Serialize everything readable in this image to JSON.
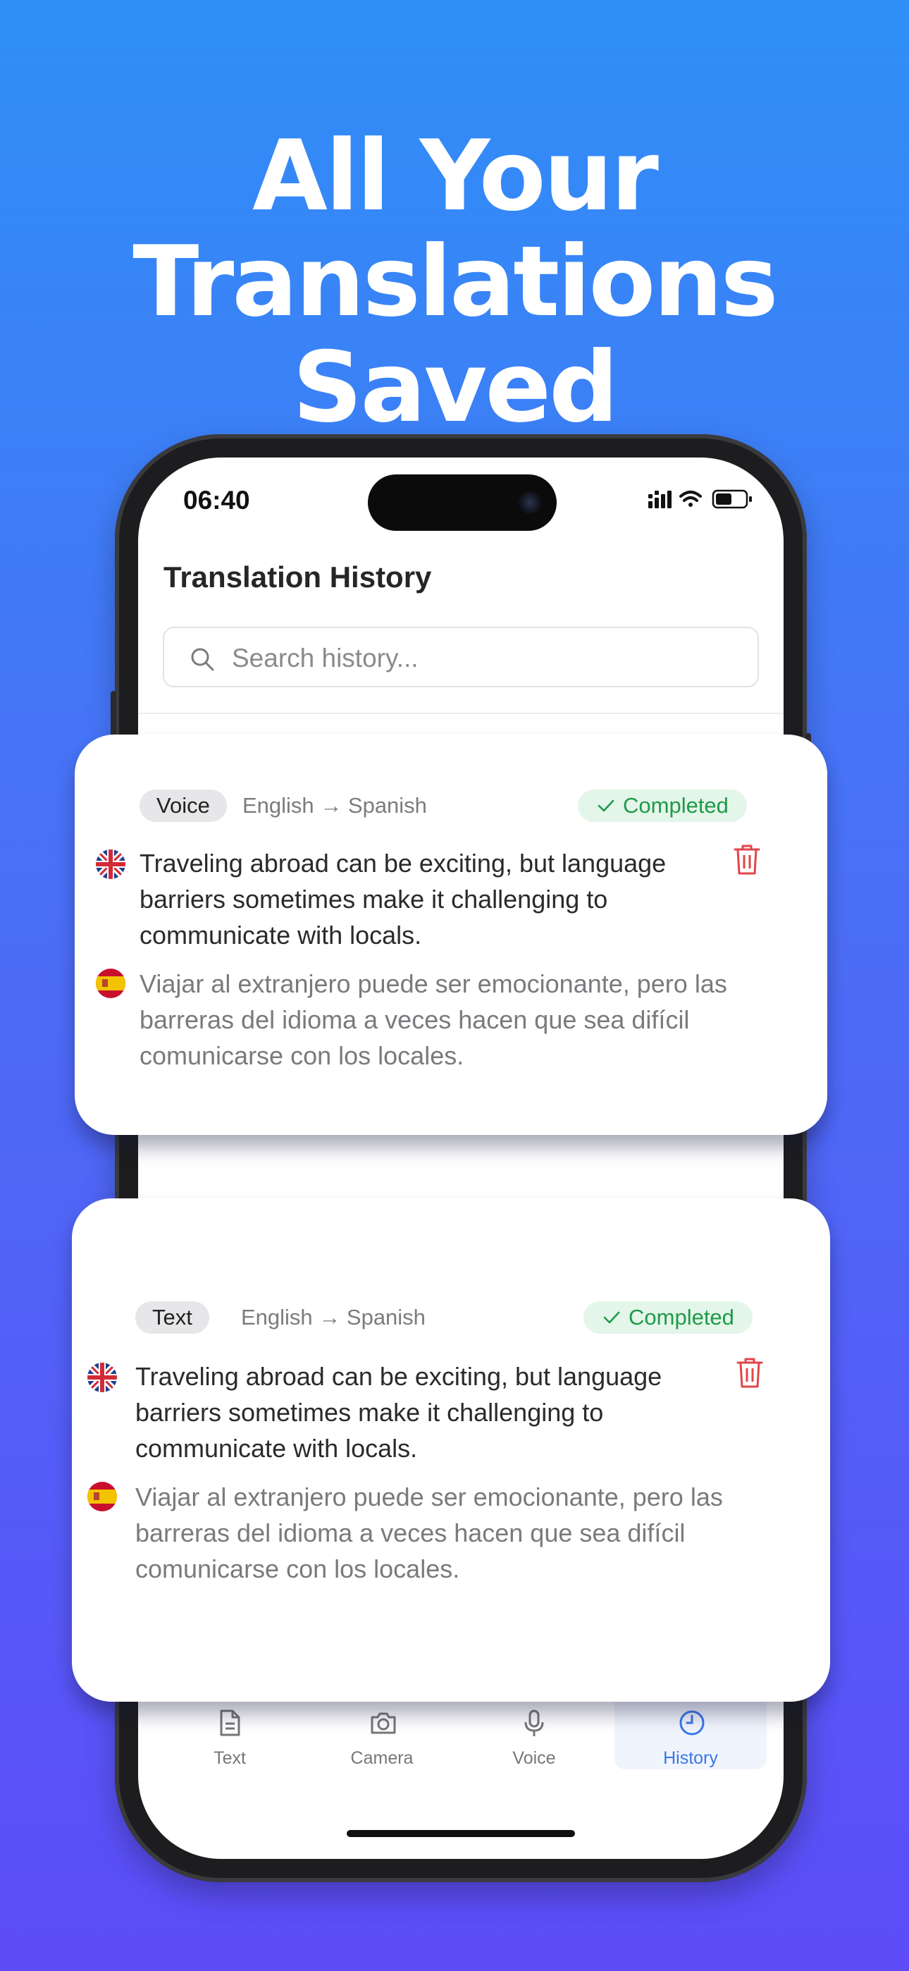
{
  "headline": {
    "line1": "All Your",
    "line2": "Translations Saved"
  },
  "status_bar": {
    "time": "06:40"
  },
  "screen": {
    "title": "Translation History",
    "search": {
      "placeholder": "Search history..."
    }
  },
  "history": [
    {
      "type": "Voice",
      "languages": "English → Spanish",
      "status": "Completed",
      "source_text": "Traveling abroad can be exciting, but language barriers sometimes make it challenging to communicate with locals.",
      "translated_text": "Viajar al extranjero puede ser emocionante, pero las barreras del idioma a veces hacen que sea difícil comunicarse con los locales."
    },
    {
      "type": "Text",
      "languages": "English → Spanish",
      "status": "Completed",
      "source_text": "Traveling abroad can be exciting, but language barriers sometimes make it challenging to communicate with locals.",
      "translated_text": "Viajar al extranjero puede ser emocionante, pero las barreras del idioma a veces hacen que sea difícil comunicarse con los locales."
    }
  ],
  "tabs": [
    {
      "label": "Text",
      "icon": "document-icon",
      "active": false
    },
    {
      "label": "Camera",
      "icon": "camera-icon",
      "active": false
    },
    {
      "label": "Voice",
      "icon": "microphone-icon",
      "active": false
    },
    {
      "label": "History",
      "icon": "clock-icon",
      "active": true
    }
  ],
  "colors": {
    "background_top": "#2f8ff7",
    "background_bottom": "#5d4cf8",
    "status_completed": "#1f9a4a",
    "delete_red": "#e0464a",
    "active_tab": "#3a78e8"
  }
}
